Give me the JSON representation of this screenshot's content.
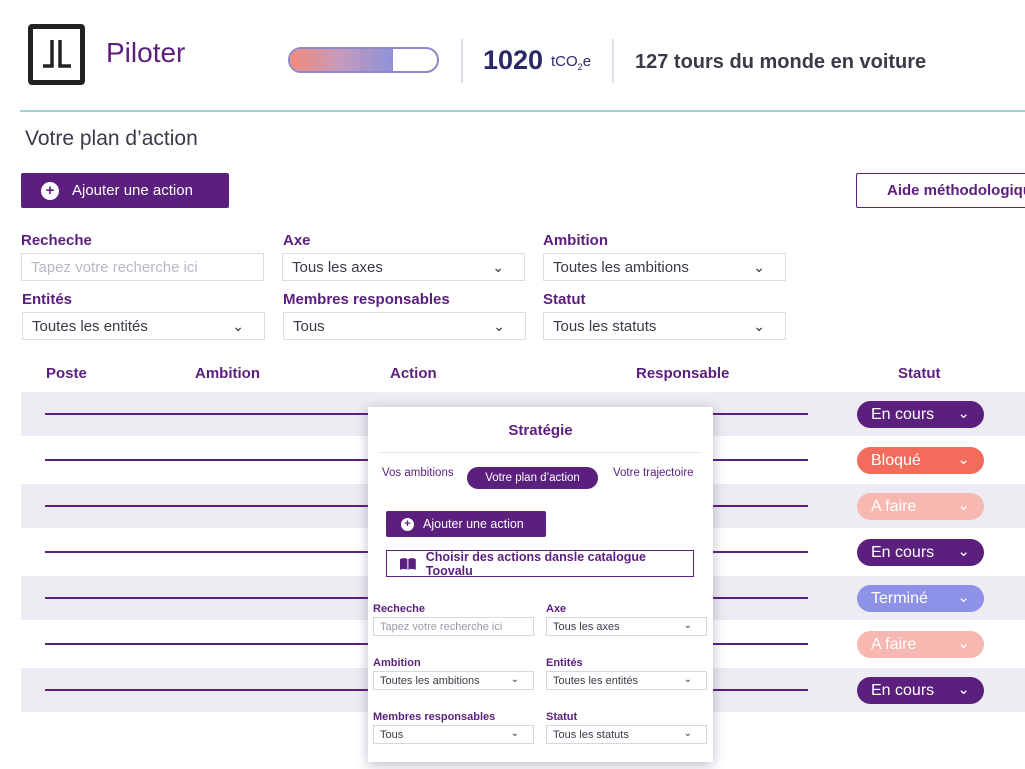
{
  "header": {
    "app_title": "Piloter",
    "emissions_value": "1020",
    "emissions_unit_prefix": "tCO",
    "emissions_unit_sub": "2",
    "emissions_unit_suffix": "e",
    "equivalent": "127 tours du monde en voiture",
    "progress_fraction": 0.7
  },
  "page": {
    "title": "Votre plan d’action",
    "add_action_label": "Ajouter une action",
    "help_label": "Aide méthodologique"
  },
  "filters": {
    "search_label": "Recheche",
    "search_placeholder": "Tapez votre recherche ici",
    "axis_label": "Axe",
    "axis_value": "Tous les axes",
    "ambition_label": "Ambition",
    "ambition_value": "Toutes les ambitions",
    "entities_label": "Entités",
    "entities_value": "Toutes les entités",
    "members_label": "Membres responsables",
    "members_value": "Tous",
    "status_label": "Statut",
    "status_value": "Tous les statuts"
  },
  "table": {
    "columns": [
      "Poste",
      "Ambition",
      "Action",
      "Responsable",
      "Statut"
    ],
    "rows": [
      {
        "status": "En cours",
        "color": "#5b1f7e"
      },
      {
        "status": "Bloqué",
        "color": "#f26b5b"
      },
      {
        "status": "A faire",
        "color": "#f6b8b0"
      },
      {
        "status": "En cours",
        "color": "#5b1f7e"
      },
      {
        "status": "Terminé",
        "color": "#8d92e8"
      },
      {
        "status": "A faire",
        "color": "#f6b8b0"
      },
      {
        "status": "En cours",
        "color": "#5b1f7e"
      }
    ]
  },
  "panel": {
    "title": "Stratégie",
    "tabs": [
      "Vos ambitions",
      "Votre plan d’action",
      "Votre trajectoire"
    ],
    "add_action_label": "Ajouter une action",
    "catalog_label": "Choisir des actions dansle catalogue Toovalu",
    "search_label": "Recheche",
    "search_placeholder": "Tapez votre recherche ici",
    "axis_label": "Axe",
    "axis_value": "Tous les axes",
    "ambition_label": "Ambition",
    "ambition_value": "Toutes les ambitions",
    "entities_label": "Entités",
    "entities_value": "Toutes les entités",
    "members_label": "Membres responsables",
    "members_value": "Tous",
    "status_label": "Statut",
    "status_value": "Tous les statuts"
  },
  "icons": {
    "logo": "jl-logo-icon",
    "plus": "plus-circle-icon",
    "help": "books-icon",
    "catalog": "open-book-icon",
    "chevron": "chevron-down-icon"
  }
}
